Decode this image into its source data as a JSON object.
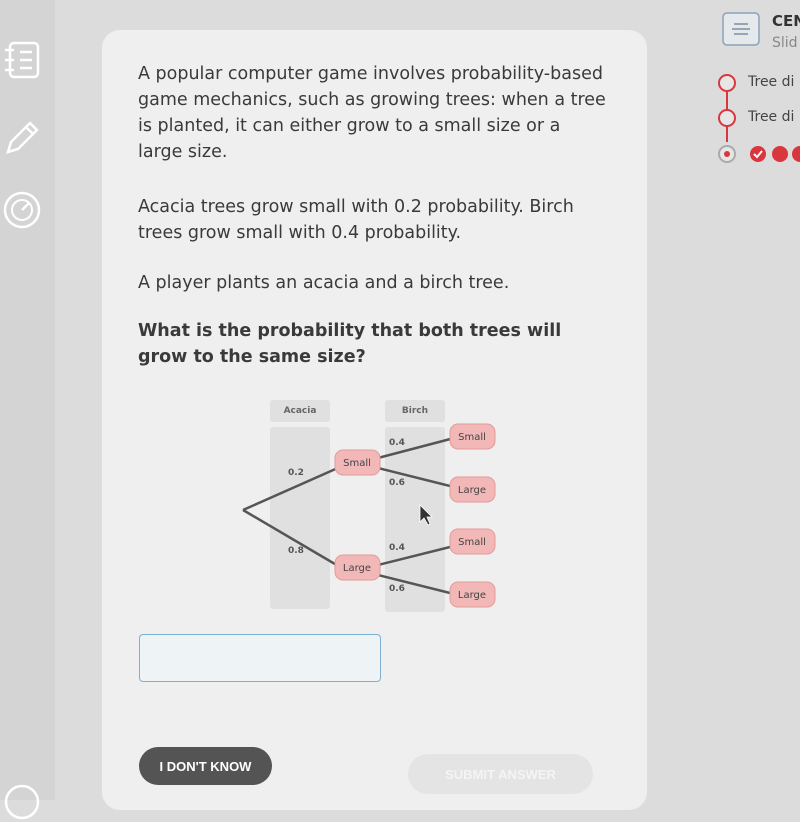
{
  "sidebar": {
    "icons": [
      "notebook-icon",
      "pencil-icon",
      "gauge-icon",
      "help-icon"
    ]
  },
  "question": {
    "paragraphs": [
      "A popular computer game involves probability-based game mechanics, such as growing trees: when a tree is planted, it can either grow to a small size or a large size.",
      "Acacia trees grow small with 0.2 probability. Birch trees grow small with 0.4 probability.",
      "A player plants an acacia and a birch tree."
    ],
    "prompt": "What is the probability that both trees will grow to the same size?"
  },
  "tree": {
    "col1": "Acacia",
    "col2": "Birch",
    "acacia_small_p": "0.2",
    "acacia_large_p": "0.8",
    "node_small": "Small",
    "node_large": "Large",
    "birch_small_p": "0.4",
    "birch_large_p": "0.6"
  },
  "answer": {
    "value": ""
  },
  "buttons": {
    "dont_know": "I DON'T KNOW",
    "submit": "SUBMIT ANSWER"
  },
  "panel": {
    "title": "CEN",
    "subtitle": "Slid",
    "steps": [
      "Tree di",
      "Tree di"
    ]
  },
  "colors": {
    "accent": "#d9363e",
    "node_fill": "#f2b8b8",
    "input_border": "#7fb0cf"
  }
}
